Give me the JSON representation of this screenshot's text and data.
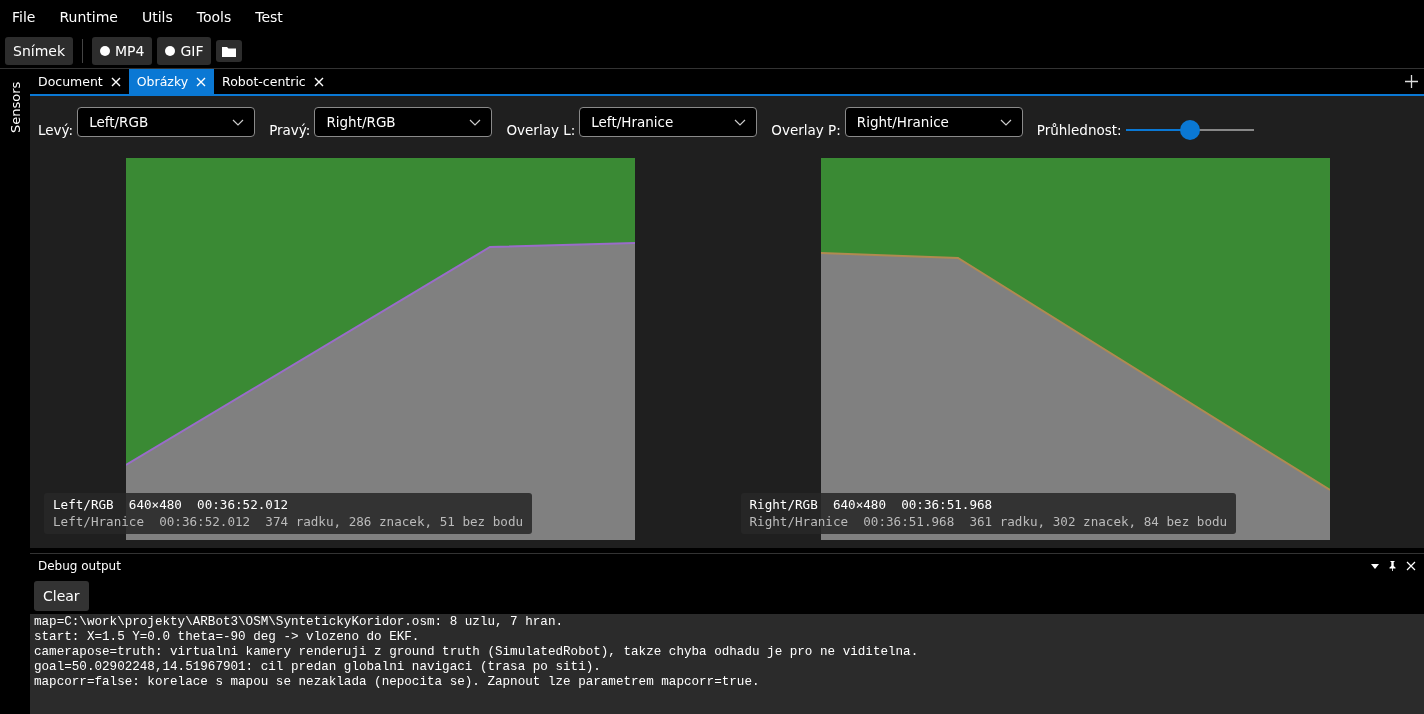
{
  "menu": [
    "File",
    "Runtime",
    "Utils",
    "Tools",
    "Test"
  ],
  "toolbar": [
    {
      "kind": "text",
      "label": "Snímek"
    },
    {
      "kind": "divider"
    },
    {
      "kind": "record",
      "label": "MP4"
    },
    {
      "kind": "record",
      "label": "GIF"
    },
    {
      "kind": "folder"
    }
  ],
  "side_panel": {
    "title": "Sensors"
  },
  "tabs": [
    {
      "label": "Document",
      "selected": false
    },
    {
      "label": "Obrázky",
      "selected": true
    },
    {
      "label": "Robot-centric",
      "selected": false
    }
  ],
  "controls": {
    "selectors": [
      {
        "label": "Levý:",
        "value": "Left/RGB"
      },
      {
        "label": "Pravý:",
        "value": "Right/RGB"
      },
      {
        "label": "Overlay L:",
        "value": "Left/Hranice"
      },
      {
        "label": "Overlay P:",
        "value": "Right/Hranice"
      }
    ],
    "opacity": {
      "label": "Průhlednost:",
      "level": 0.5
    }
  },
  "views": [
    {
      "kind": "left",
      "line1": "Left/RGB  640×480  00:36:52.012",
      "line2": "Left/Hranice  00:36:52.012  374 radku, 286 znacek, 51 bez bodu"
    },
    {
      "kind": "right",
      "line1": "Right/RGB  640×480  00:36:51.968",
      "line2": "Right/Hranice  00:36:51.968  361 radku, 302 znacek, 84 bez bodu"
    }
  ],
  "debug": {
    "title": "Debug output",
    "button": "Clear",
    "lines": [
      "map=C:\\work\\projekty\\ARBot3\\OSM\\SyntetickyKoridor.osm: 8 uzlu, 7 hran.",
      "start: X=1.5 Y=0.0 theta=-90 deg -> vlozeno do EKF.",
      "camerapose=truth: virtualni kamery renderuji z ground truth (SimulatedRobot), takze chyba odhadu je pro ne viditelna.",
      "goal=50.02902248,14.51967901: cil predan globalni navigaci (trasa po siti).",
      "mapcorr=false: korelace s mapou se nezaklada (nepocita se). Zapnout lze parametrem mapcorr=true."
    ]
  }
}
